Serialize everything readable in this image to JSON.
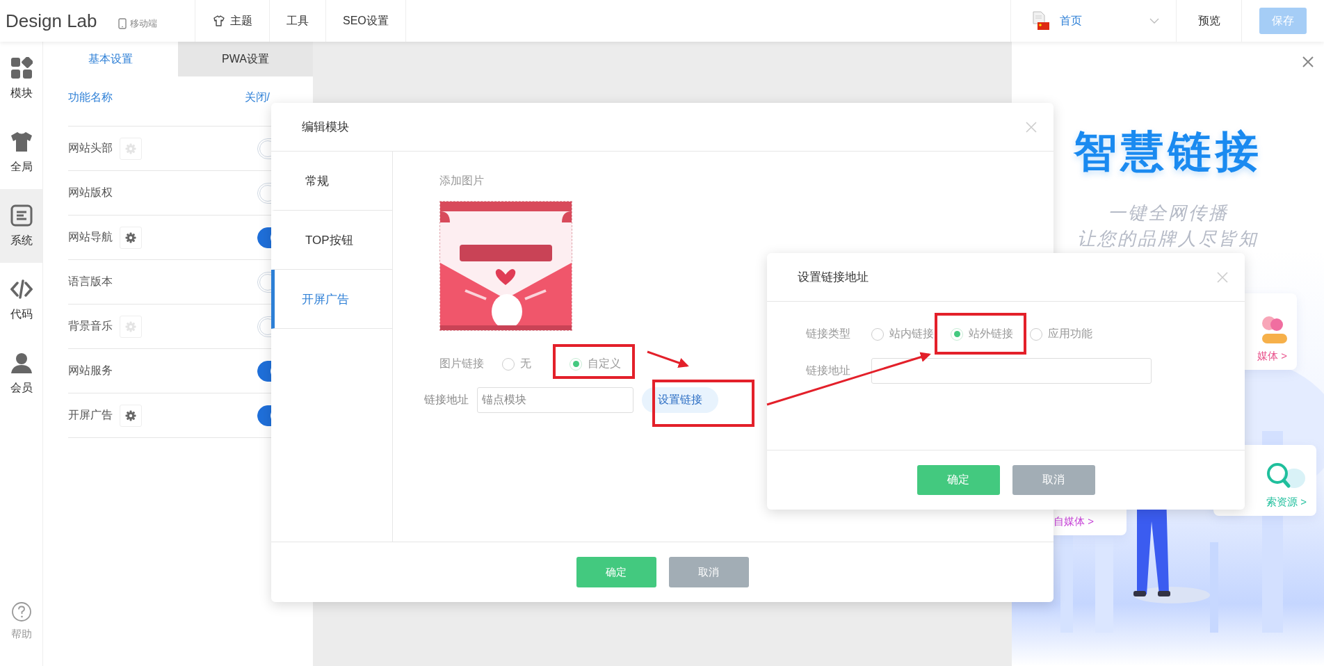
{
  "topbar": {
    "logo": "Design Lab",
    "device": "移动端",
    "nav": [
      {
        "label": "主题"
      },
      {
        "label": "工具"
      },
      {
        "label": "SEO设置"
      }
    ],
    "page_select": {
      "value": "首页"
    },
    "preview": "预览",
    "save": {
      "label": "保存",
      "disabled": true
    }
  },
  "rail": {
    "items": [
      {
        "label": "模块",
        "selected": false
      },
      {
        "label": "全局",
        "selected": false
      },
      {
        "label": "系统",
        "selected": true
      },
      {
        "label": "代码",
        "selected": false
      },
      {
        "label": "会员",
        "selected": false
      }
    ],
    "help": {
      "label": "帮助"
    }
  },
  "settings": {
    "tabs": [
      {
        "label": "基本设置",
        "selected": true
      },
      {
        "label": "PWA设置",
        "selected": false
      }
    ],
    "columns": [
      "功能名称",
      "关闭/"
    ],
    "rows": [
      {
        "name": "网站头部",
        "gear": {
          "disabled": true
        },
        "on": false
      },
      {
        "name": "网站版权",
        "on": false
      },
      {
        "name": "网站导航",
        "gear": {
          "disabled": false
        },
        "on": true
      },
      {
        "name": "语言版本",
        "on": false
      },
      {
        "name": "背景音乐",
        "gear": {
          "disabled": true
        },
        "on": false
      },
      {
        "name": "网站服务",
        "on": true
      },
      {
        "name": "开屏广告",
        "gear": {
          "disabled": false
        },
        "on": true
      }
    ]
  },
  "promo": {
    "title": "智慧链接",
    "subtitle": [
      "一键全网传播",
      "让您的品牌人尽皆知"
    ],
    "cards": [
      {
        "label": "媒体 >",
        "color": "#e8508a",
        "kind": "people"
      },
      {
        "label": "自媒体 >",
        "color": "#c743d8",
        "kind": "plain"
      },
      {
        "label": "索资源 >",
        "color": "#1fbf9c",
        "kind": "search"
      }
    ]
  },
  "edit_modal": {
    "title": "编辑模块",
    "tabs": [
      {
        "label": "常规",
        "selected": false
      },
      {
        "label": "TOP按钮",
        "selected": false
      },
      {
        "label": "开屏广告",
        "selected": true
      }
    ],
    "image_label": "添加图片",
    "link_label": "图片链接",
    "link_options": [
      {
        "label": "无",
        "selected": false
      },
      {
        "label": "自定义",
        "selected": true
      }
    ],
    "address_label": "链接地址",
    "address_value": "锚点模块",
    "set_link": "设置链接",
    "buttons": [
      {
        "label": "确定",
        "kind": "primary"
      },
      {
        "label": "取消",
        "kind": "secondary"
      }
    ]
  },
  "link_modal": {
    "title": "设置链接地址",
    "type_label": "链接类型",
    "types": [
      {
        "label": "站内链接",
        "selected": false
      },
      {
        "label": "站外链接",
        "selected": true
      },
      {
        "label": "应用功能",
        "selected": false
      }
    ],
    "address_label": "链接地址",
    "buttons": [
      {
        "label": "确定",
        "kind": "primary"
      },
      {
        "label": "取消",
        "kind": "secondary"
      }
    ]
  }
}
